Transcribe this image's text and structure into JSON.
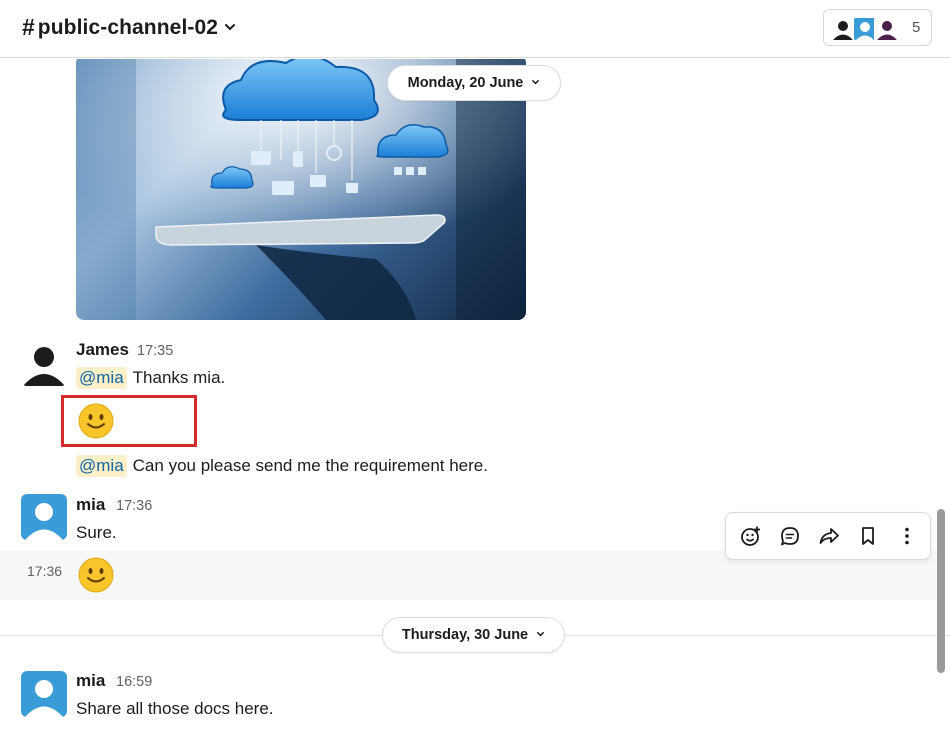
{
  "header": {
    "channel_prefix": "#",
    "channel_name": "public-channel-02",
    "member_count": "5"
  },
  "dates": {
    "first": "Monday, 20 June",
    "second": "Thursday, 30 June"
  },
  "messages": [
    {
      "author": "James",
      "time": "17:35",
      "lines": [
        {
          "mention": "@mia",
          "text": "Thanks mia."
        },
        {
          "emoji": "slightly-smiling-face"
        },
        {
          "mention": "@mia",
          "text": "Can you please send me the requirement here."
        }
      ]
    },
    {
      "author": "mia",
      "time": "17:36",
      "lines": [
        {
          "text": "Sure."
        },
        {
          "time": "17:36",
          "emoji": "slightly-smiling-face"
        }
      ]
    },
    {
      "author": "mia",
      "time": "16:59",
      "lines": [
        {
          "text": "Share all those docs here."
        }
      ]
    }
  ],
  "colors": {
    "mention_bg": "#fdf0c9",
    "mention_text": "#1264a3",
    "highlight_border": "#d32b2b",
    "avatar_blue": "#3a9bd9"
  },
  "icons": {
    "action_bar": [
      "add-reaction-icon",
      "reply-in-thread-icon",
      "share-icon",
      "bookmark-icon",
      "more-actions-icon"
    ]
  }
}
